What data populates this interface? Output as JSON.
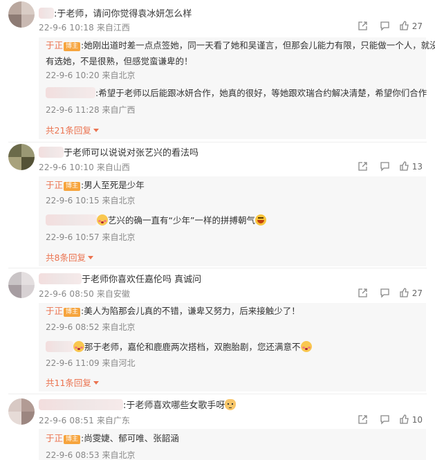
{
  "threads": [
    {
      "comment": {
        "text": ":于老师，请问你觉得袁冰妍怎么样",
        "date": "22-9-6 10:18",
        "location": "来自江西",
        "likes": "27"
      },
      "replies": [
        {
          "author": "于正",
          "badge": "博主",
          "text": ":她刚出道时差一点点签她，同一天看了她和吴谨言，但那会儿能力有限，只能做一个人，就没",
          "text2": "有选她，不是很熟，但感觉蛮谦卑的！",
          "date": "22-9-6 10:20",
          "location": "来自北京"
        },
        {
          "text": ":希望于老师以后能跟冰妍合作，她真的很好，等她跟欢瑞合约解决清楚，希望你们合作",
          "date": "22-9-6 11:28",
          "location": "来自广西"
        }
      ],
      "more": "共21条回复"
    },
    {
      "comment": {
        "text": "于老师可以说说对张艺兴的看法吗",
        "date": "22-9-6 10:10",
        "location": "来自山西",
        "likes": "13"
      },
      "replies": [
        {
          "author": "于正",
          "badge": "博主",
          "text": ":男人至死是少年",
          "date": "22-9-6 10:15",
          "location": "来自北京"
        },
        {
          "text": "艺兴的确一直有“少年”一样的拼搏朝气",
          "date": "22-9-6 10:57",
          "location": "来自北京"
        }
      ],
      "more": "共8条回复"
    },
    {
      "comment": {
        "text": "于老师你喜欢任嘉伦吗 真诚问",
        "date": "22-9-6 08:50",
        "location": "来自安徽",
        "likes": "27"
      },
      "replies": [
        {
          "author": "于正",
          "badge": "博主",
          "text": ":美人为陷那会儿真的不错，谦卑又努力，后来接触少了！",
          "date": "22-9-6 08:52",
          "location": "来自北京"
        },
        {
          "text": "那于老师，嘉伦和鹿鹿两次搭档，双胞胎剧，您还满意不",
          "date": "22-9-6 11:09",
          "location": "来自河北"
        }
      ],
      "more": "共11条回复"
    },
    {
      "comment": {
        "text": ":于老师喜欢哪些女歌手呀",
        "date": "22-9-6 08:51",
        "location": "来自广东",
        "likes": "10"
      },
      "replies": [
        {
          "author": "于正",
          "badge": "博主",
          "text": ":尚雯婕、郁可唯、张韶涵",
          "date": "22-9-6 08:53",
          "location": "来自北京"
        }
      ]
    }
  ],
  "icons": [
    "share-icon",
    "comment-icon",
    "like-icon"
  ],
  "colors": {
    "accent": "#eb7350",
    "badge": "#f6a43d",
    "meta": "#888888",
    "reply_bg": "#f7f7f7"
  }
}
